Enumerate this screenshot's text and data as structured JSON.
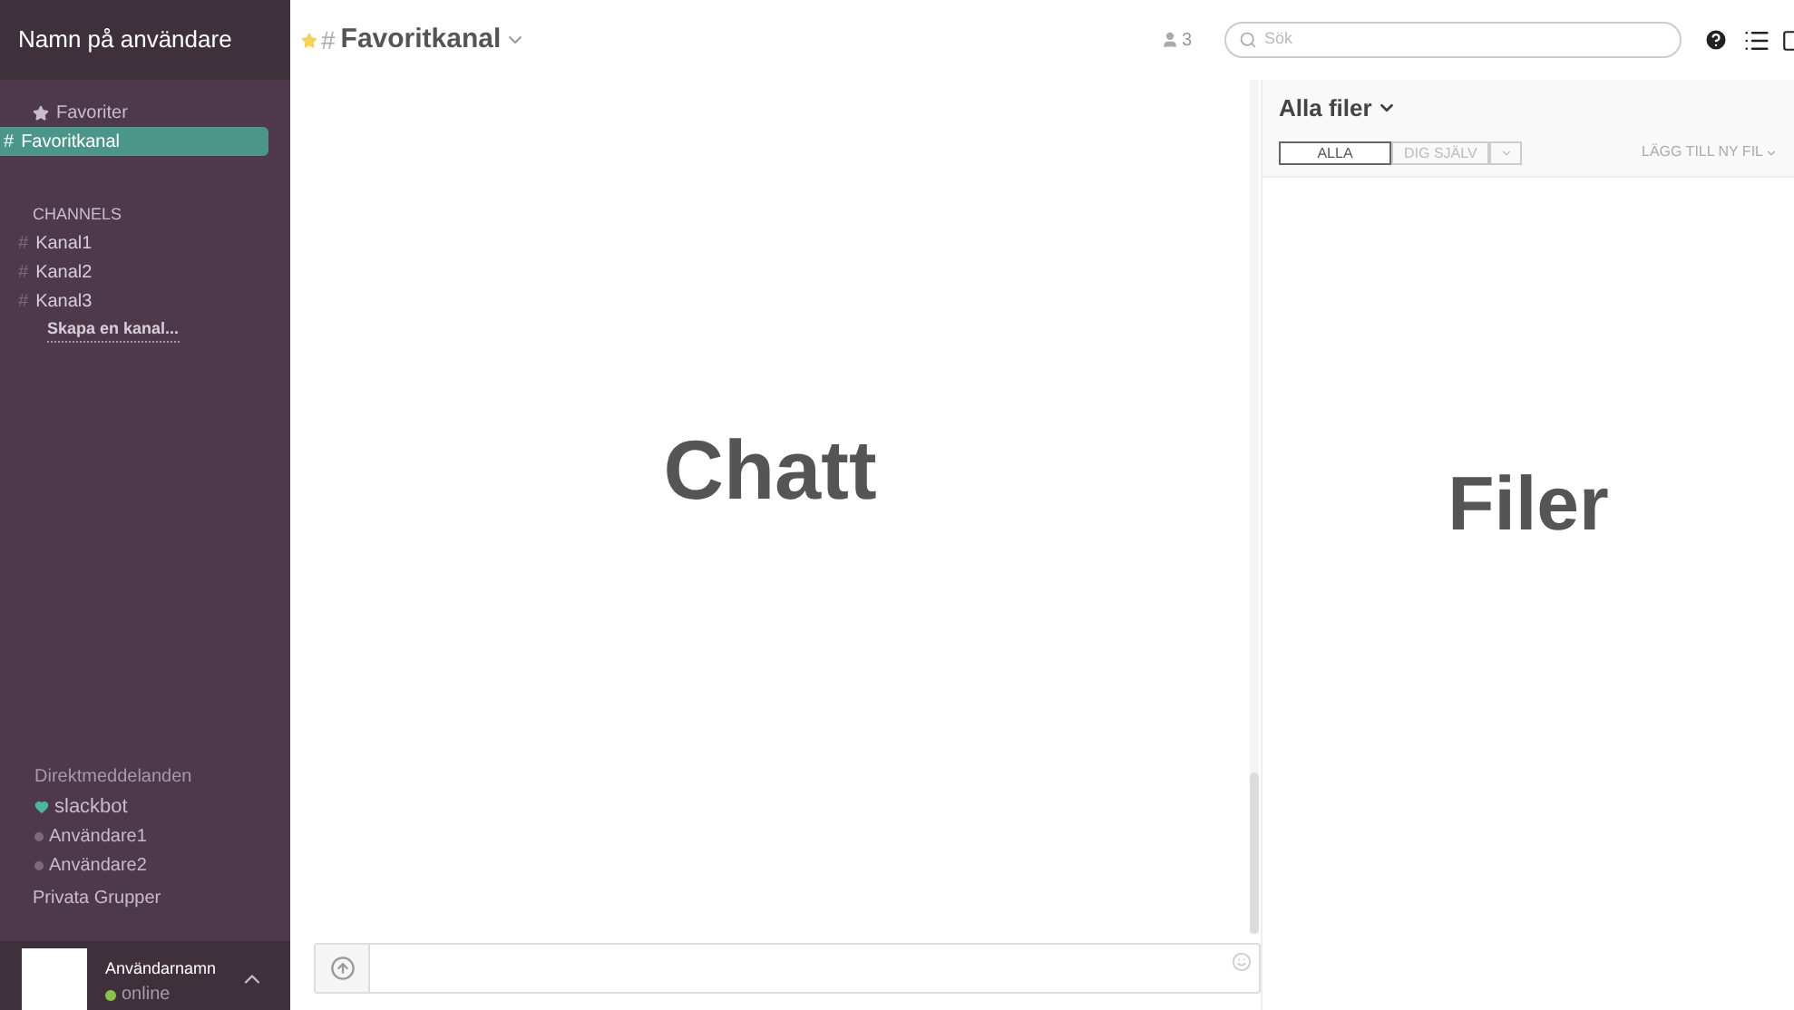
{
  "sidebar": {
    "team_name": "Namn på användare",
    "favorites": {
      "label": "Favoriter",
      "items": [
        {
          "prefix": "#",
          "name": "Favoritkanal",
          "selected": true
        }
      ]
    },
    "channels": {
      "label": "CHANNELS",
      "items": [
        {
          "prefix": "#",
          "name": "Kanal1",
          "selected": false
        },
        {
          "prefix": "#",
          "name": "Kanal2",
          "selected": false
        },
        {
          "prefix": "#",
          "name": "Kanal3",
          "selected": false
        }
      ],
      "create_link": "Skapa en kanal..."
    },
    "direct_messages": {
      "label": "Direktmeddelanden",
      "items": [
        {
          "kind": "heart",
          "name": "slackbot",
          "color": "#4cb69f"
        },
        {
          "kind": "dot",
          "name": "Användare1",
          "color": "#7e6a7b"
        },
        {
          "kind": "dot",
          "name": "Användare2",
          "color": "#7e6a7b"
        }
      ]
    },
    "private_groups": {
      "label": "Privata Grupper"
    },
    "user": {
      "name": "Användarnamn",
      "status": {
        "label": "online",
        "color": "#8bc34a"
      }
    }
  },
  "header": {
    "starred": true,
    "prefix": "#",
    "channel": "Favoritkanal",
    "member_count": "3",
    "search": {
      "placeholder": "Sök"
    }
  },
  "chat": {
    "label": "Chatt",
    "scroll": {
      "level": 0.19
    }
  },
  "files": {
    "title": "Alla filer",
    "tabs": [
      {
        "label": "ALLA",
        "selected": true
      },
      {
        "label": "DIG SJÄLV",
        "selected": false
      }
    ],
    "add_button": "LÄGG TILL NY FIL",
    "label": "Filer"
  }
}
